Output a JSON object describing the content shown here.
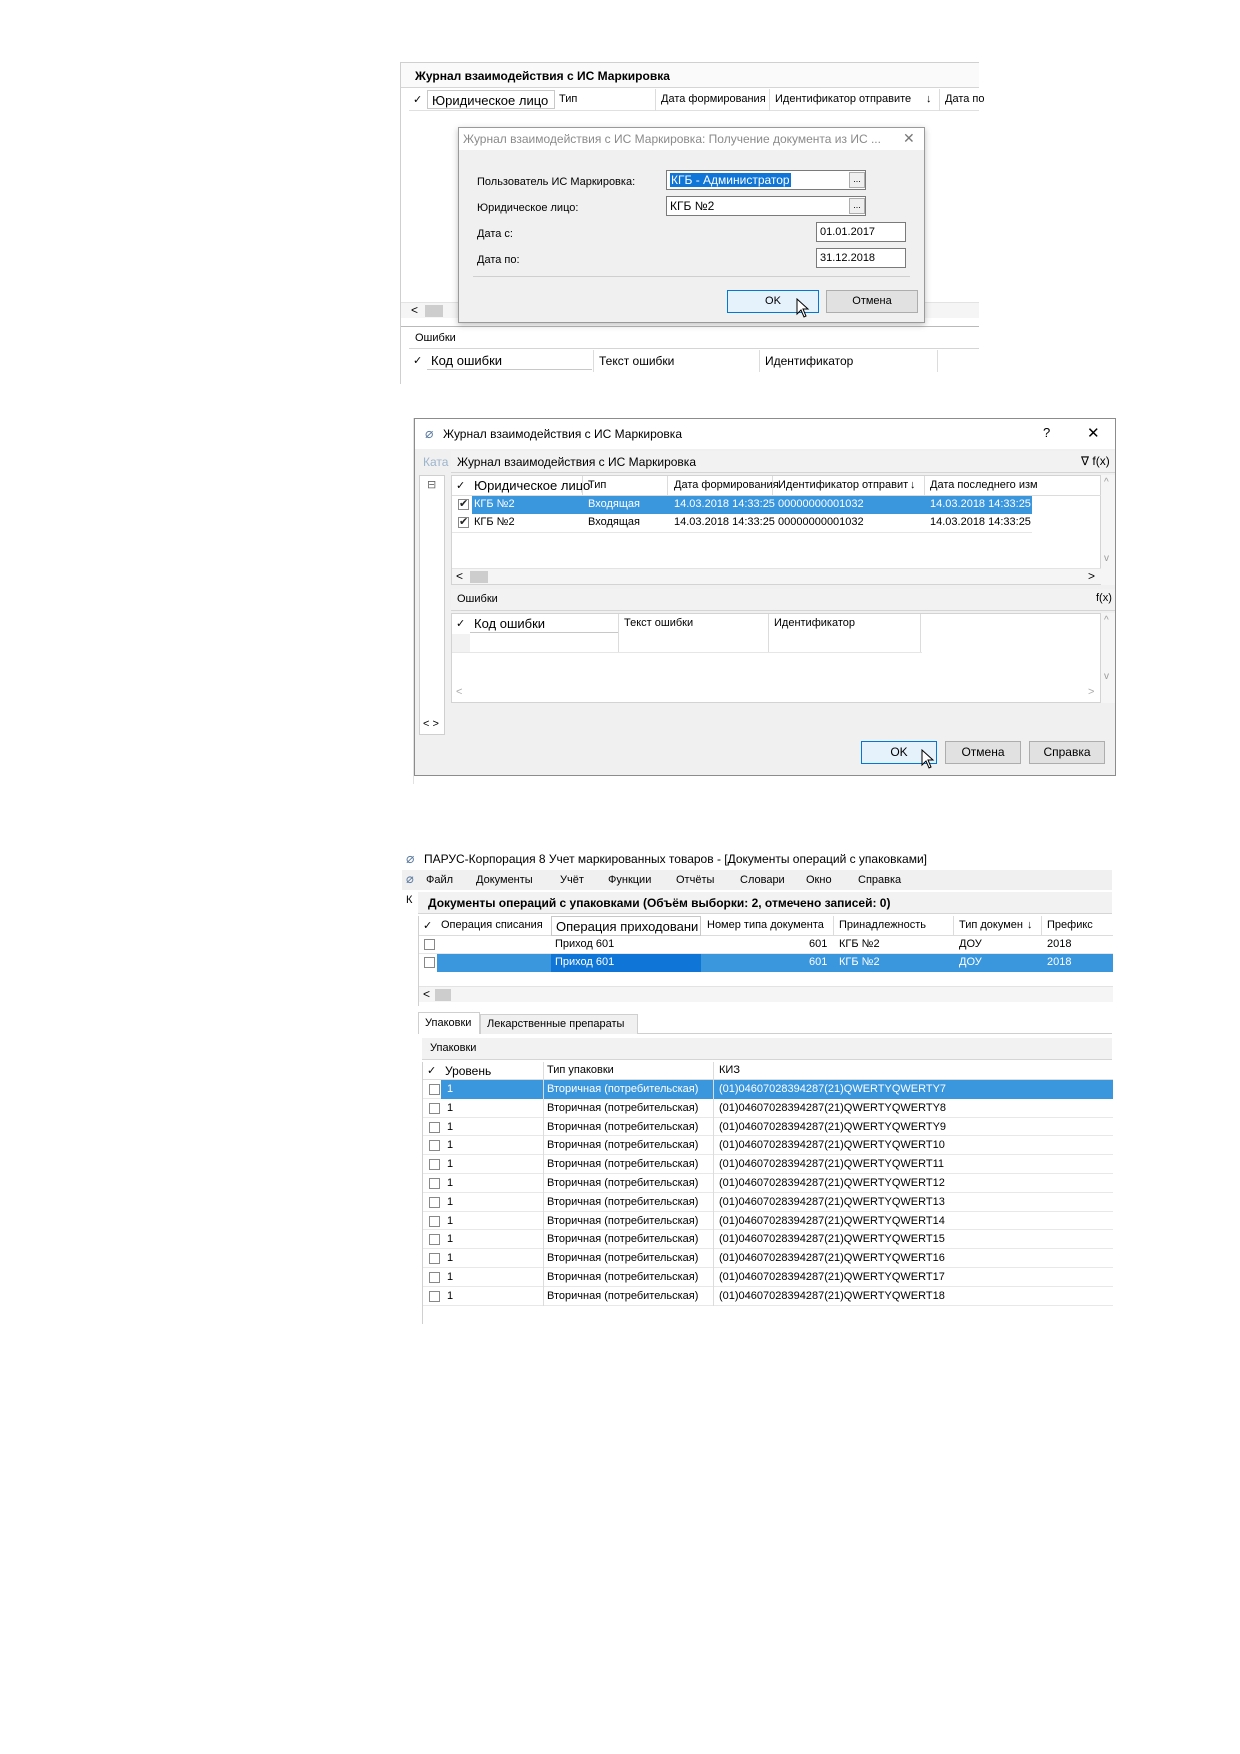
{
  "shot1": {
    "panel_title": "Журнал взаимодействия с ИС Маркировка",
    "grid_headers": [
      "✓",
      "Юридическое лицо",
      "Тип",
      "Дата формирования",
      "Идентификатор отправите",
      "↓",
      "Дата по"
    ],
    "dialog": {
      "title": "Журнал взаимодействия с ИС Маркировка: Получение документа из ИС ...",
      "close_glyph": "✕",
      "fields": [
        {
          "label": "Пользователь ИС Маркировка:",
          "value": "КГБ - Администратор"
        },
        {
          "label": "Юридическое лицо:",
          "value": "КГБ №2"
        },
        {
          "label": "Дата с:",
          "value": "01.01.2017"
        },
        {
          "label": "Дата по:",
          "value": "31.12.2018"
        }
      ],
      "ellipsis": "...",
      "ok": "OK",
      "cancel": "Отмена"
    },
    "errors_title": "Ошибки",
    "errors_headers": [
      "✓",
      "Код ошибки",
      "Текст ошибки",
      "Идентификатор"
    ],
    "scroll_left": "<"
  },
  "shot2": {
    "window_title": "Журнал взаимодействия с ИС Маркировка",
    "help_glyph": "?",
    "close_glyph": "✕",
    "side_label": "Ката",
    "panel_title": "Журнал взаимодействия с ИС Маркировка",
    "panel_tools": "∇ f(x)",
    "grid_headers": [
      "✓",
      "Юридическое лицо",
      "Тип",
      "Дата формирования",
      "Идентификатор отправите",
      "↓",
      "Дата последнего изм"
    ],
    "rows": [
      {
        "checked": true,
        "org": "КГБ №2",
        "type": "Входящая",
        "date": "14.03.2018 14:33:25",
        "id": "00000000001032",
        "last": "14.03.2018 14:33:25"
      },
      {
        "checked": true,
        "org": "КГБ №2",
        "type": "Входящая",
        "date": "14.03.2018 14:33:25",
        "id": "00000000001032",
        "last": "14.03.2018 14:33:25"
      }
    ],
    "errors_title": "Ошибки",
    "errors_tools": "f(x)",
    "errors_headers": [
      "✓",
      "Код ошибки",
      "Текст ошибки",
      "Идентификатор"
    ],
    "tree_toggle": "⊟",
    "nav_arrows": "< >",
    "scroll_left": "<",
    "scroll_right": ">",
    "scroll_up": "^",
    "scroll_down": "v",
    "ok": "OK",
    "cancel": "Отмена",
    "help": "Справка"
  },
  "shot3": {
    "window_title": "ПАРУС-Корпорация 8 Учет маркированных товаров - [Документы операций с упаковками]",
    "menu": [
      "Файл",
      "Документы",
      "Учёт",
      "Функции",
      "Отчёты",
      "Словари",
      "Окно",
      "Справка"
    ],
    "side_letter": "К",
    "panel_title": "Документы операций с упаковками (Объём выборки: 2, отмечено записей: 0)",
    "grid_headers": [
      "✓",
      "Операция списания",
      "Операция приходовани",
      "Номер типа документа",
      "Принадлежность",
      "Тип докумен",
      "↓",
      "Префикс"
    ],
    "rows": [
      {
        "op_in": "Приход 601",
        "num": "601",
        "owner": "КГБ №2",
        "doctype": "ДОУ",
        "prefix": "2018"
      },
      {
        "op_in": "Приход 601",
        "num": "601",
        "owner": "КГБ №2",
        "doctype": "ДОУ",
        "prefix": "2018"
      }
    ],
    "scroll_left": "<",
    "tabs": [
      "Упаковки",
      "Лекарственные препараты"
    ],
    "packs_title": "Упаковки",
    "packs_headers": [
      "✓",
      "Уровень",
      "Тип упаковки",
      "КИЗ"
    ],
    "packs": [
      {
        "level": "1",
        "type": "Вторичная (потребительская)",
        "kiz": "(01)04607028394287(21)QWERTYQWERTY7"
      },
      {
        "level": "1",
        "type": "Вторичная (потребительская)",
        "kiz": "(01)04607028394287(21)QWERTYQWERTY8"
      },
      {
        "level": "1",
        "type": "Вторичная (потребительская)",
        "kiz": "(01)04607028394287(21)QWERTYQWERTY9"
      },
      {
        "level": "1",
        "type": "Вторичная (потребительская)",
        "kiz": "(01)04607028394287(21)QWERTYQWERT10"
      },
      {
        "level": "1",
        "type": "Вторичная (потребительская)",
        "kiz": "(01)04607028394287(21)QWERTYQWERT11"
      },
      {
        "level": "1",
        "type": "Вторичная (потребительская)",
        "kiz": "(01)04607028394287(21)QWERTYQWERT12"
      },
      {
        "level": "1",
        "type": "Вторичная (потребительская)",
        "kiz": "(01)04607028394287(21)QWERTYQWERT13"
      },
      {
        "level": "1",
        "type": "Вторичная (потребительская)",
        "kiz": "(01)04607028394287(21)QWERTYQWERT14"
      },
      {
        "level": "1",
        "type": "Вторичная (потребительская)",
        "kiz": "(01)04607028394287(21)QWERTYQWERT15"
      },
      {
        "level": "1",
        "type": "Вторичная (потребительская)",
        "kiz": "(01)04607028394287(21)QWERTYQWERT16"
      },
      {
        "level": "1",
        "type": "Вторичная (потребительская)",
        "kiz": "(01)04607028394287(21)QWERTYQWERT17"
      },
      {
        "level": "1",
        "type": "Вторичная (потребительская)",
        "kiz": "(01)04607028394287(21)QWERTYQWERT18"
      }
    ]
  },
  "colors": {
    "selection": "#3a96dd",
    "selection_dark": "#0f75d6",
    "header_bg": "#f2f2f2",
    "button_primary_border": "#0078d7"
  }
}
